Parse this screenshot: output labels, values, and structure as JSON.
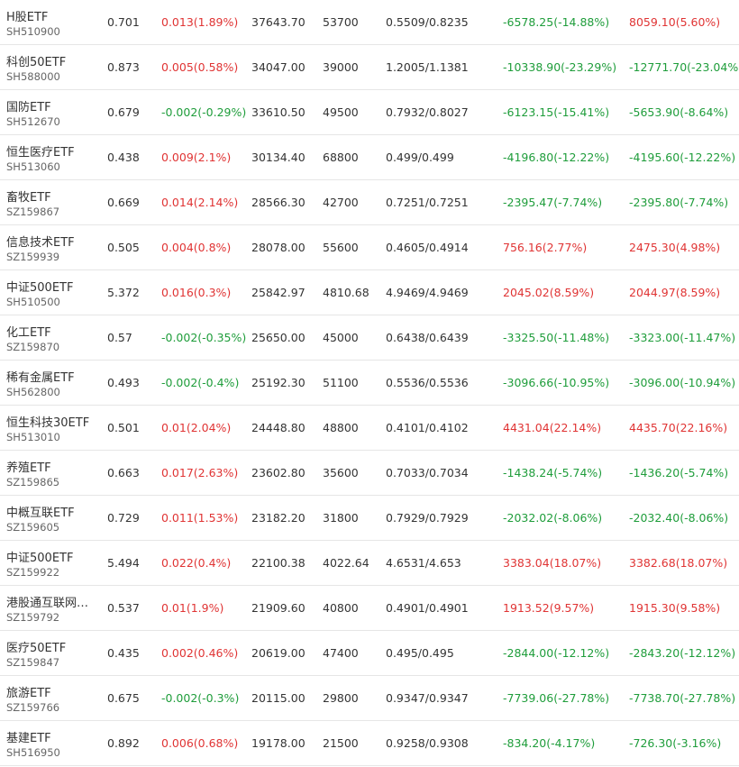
{
  "colors": {
    "up": "#e03434",
    "down": "#1f9d3b",
    "text": "#333333",
    "subtext": "#666666",
    "divider": "#e6e6e6"
  },
  "rows": [
    {
      "name": "H股ETF",
      "code": "SH510900",
      "price": "0.701",
      "change": "0.013(1.89%)",
      "change_dir": "up",
      "vol": "37643.70",
      "amount": "53700",
      "bidask": "0.5509/0.8235",
      "p1": "-6578.25(-14.88%)",
      "p1_dir": "down",
      "p2": "8059.10(5.60%)",
      "p2_dir": "up"
    },
    {
      "name": "科创50ETF",
      "code": "SH588000",
      "price": "0.873",
      "change": "0.005(0.58%)",
      "change_dir": "up",
      "vol": "34047.00",
      "amount": "39000",
      "bidask": "1.2005/1.1381",
      "p1": "-10338.90(-23.29%)",
      "p1_dir": "down",
      "p2": "-12771.70(-23.04%)",
      "p2_dir": "down"
    },
    {
      "name": "国防ETF",
      "code": "SH512670",
      "price": "0.679",
      "change": "-0.002(-0.29%)",
      "change_dir": "down",
      "vol": "33610.50",
      "amount": "49500",
      "bidask": "0.7932/0.8027",
      "p1": "-6123.15(-15.41%)",
      "p1_dir": "down",
      "p2": "-5653.90(-8.64%)",
      "p2_dir": "down"
    },
    {
      "name": "恒生医疗ETF",
      "code": "SH513060",
      "price": "0.438",
      "change": "0.009(2.1%)",
      "change_dir": "up",
      "vol": "30134.40",
      "amount": "68800",
      "bidask": "0.499/0.499",
      "p1": "-4196.80(-12.22%)",
      "p1_dir": "down",
      "p2": "-4195.60(-12.22%)",
      "p2_dir": "down"
    },
    {
      "name": "畜牧ETF",
      "code": "SZ159867",
      "price": "0.669",
      "change": "0.014(2.14%)",
      "change_dir": "up",
      "vol": "28566.30",
      "amount": "42700",
      "bidask": "0.7251/0.7251",
      "p1": "-2395.47(-7.74%)",
      "p1_dir": "down",
      "p2": "-2395.80(-7.74%)",
      "p2_dir": "down"
    },
    {
      "name": "信息技术ETF",
      "code": "SZ159939",
      "price": "0.505",
      "change": "0.004(0.8%)",
      "change_dir": "up",
      "vol": "28078.00",
      "amount": "55600",
      "bidask": "0.4605/0.4914",
      "p1": "756.16(2.77%)",
      "p1_dir": "up",
      "p2": "2475.30(4.98%)",
      "p2_dir": "up"
    },
    {
      "name": "中证500ETF",
      "code": "SH510500",
      "price": "5.372",
      "change": "0.016(0.3%)",
      "change_dir": "up",
      "vol": "25842.97",
      "amount": "4810.68",
      "bidask": "4.9469/4.9469",
      "p1": "2045.02(8.59%)",
      "p1_dir": "up",
      "p2": "2044.97(8.59%)",
      "p2_dir": "up"
    },
    {
      "name": "化工ETF",
      "code": "SZ159870",
      "price": "0.57",
      "change": "-0.002(-0.35%)",
      "change_dir": "down",
      "vol": "25650.00",
      "amount": "45000",
      "bidask": "0.6438/0.6439",
      "p1": "-3325.50(-11.48%)",
      "p1_dir": "down",
      "p2": "-3323.00(-11.47%)",
      "p2_dir": "down"
    },
    {
      "name": "稀有金属ETF",
      "code": "SH562800",
      "price": "0.493",
      "change": "-0.002(-0.4%)",
      "change_dir": "down",
      "vol": "25192.30",
      "amount": "51100",
      "bidask": "0.5536/0.5536",
      "p1": "-3096.66(-10.95%)",
      "p1_dir": "down",
      "p2": "-3096.00(-10.94%)",
      "p2_dir": "down"
    },
    {
      "name": "恒生科技30ETF",
      "code": "SH513010",
      "price": "0.501",
      "change": "0.01(2.04%)",
      "change_dir": "up",
      "vol": "24448.80",
      "amount": "48800",
      "bidask": "0.4101/0.4102",
      "p1": "4431.04(22.14%)",
      "p1_dir": "up",
      "p2": "4435.70(22.16%)",
      "p2_dir": "up"
    },
    {
      "name": "养殖ETF",
      "code": "SZ159865",
      "price": "0.663",
      "change": "0.017(2.63%)",
      "change_dir": "up",
      "vol": "23602.80",
      "amount": "35600",
      "bidask": "0.7033/0.7034",
      "p1": "-1438.24(-5.74%)",
      "p1_dir": "down",
      "p2": "-1436.20(-5.74%)",
      "p2_dir": "down"
    },
    {
      "name": "中概互联ETF",
      "code": "SZ159605",
      "price": "0.729",
      "change": "0.011(1.53%)",
      "change_dir": "up",
      "vol": "23182.20",
      "amount": "31800",
      "bidask": "0.7929/0.7929",
      "p1": "-2032.02(-8.06%)",
      "p1_dir": "down",
      "p2": "-2032.40(-8.06%)",
      "p2_dir": "down"
    },
    {
      "name": "中证500ETF",
      "code": "SZ159922",
      "price": "5.494",
      "change": "0.022(0.4%)",
      "change_dir": "up",
      "vol": "22100.38",
      "amount": "4022.64",
      "bidask": "4.6531/4.653",
      "p1": "3383.04(18.07%)",
      "p1_dir": "up",
      "p2": "3382.68(18.07%)",
      "p2_dir": "up"
    },
    {
      "name": "港股通互联网…",
      "code": "SZ159792",
      "price": "0.537",
      "change": "0.01(1.9%)",
      "change_dir": "up",
      "vol": "21909.60",
      "amount": "40800",
      "bidask": "0.4901/0.4901",
      "p1": "1913.52(9.57%)",
      "p1_dir": "up",
      "p2": "1915.30(9.58%)",
      "p2_dir": "up"
    },
    {
      "name": "医疗50ETF",
      "code": "SZ159847",
      "price": "0.435",
      "change": "0.002(0.46%)",
      "change_dir": "up",
      "vol": "20619.00",
      "amount": "47400",
      "bidask": "0.495/0.495",
      "p1": "-2844.00(-12.12%)",
      "p1_dir": "down",
      "p2": "-2843.20(-12.12%)",
      "p2_dir": "down"
    },
    {
      "name": "旅游ETF",
      "code": "SZ159766",
      "price": "0.675",
      "change": "-0.002(-0.3%)",
      "change_dir": "down",
      "vol": "20115.00",
      "amount": "29800",
      "bidask": "0.9347/0.9347",
      "p1": "-7739.06(-27.78%)",
      "p1_dir": "down",
      "p2": "-7738.70(-27.78%)",
      "p2_dir": "down"
    },
    {
      "name": "基建ETF",
      "code": "SH516950",
      "price": "0.892",
      "change": "0.006(0.68%)",
      "change_dir": "up",
      "vol": "19178.00",
      "amount": "21500",
      "bidask": "0.9258/0.9308",
      "p1": "-834.20(-4.17%)",
      "p1_dir": "down",
      "p2": "-726.30(-3.16%)",
      "p2_dir": "down"
    }
  ]
}
